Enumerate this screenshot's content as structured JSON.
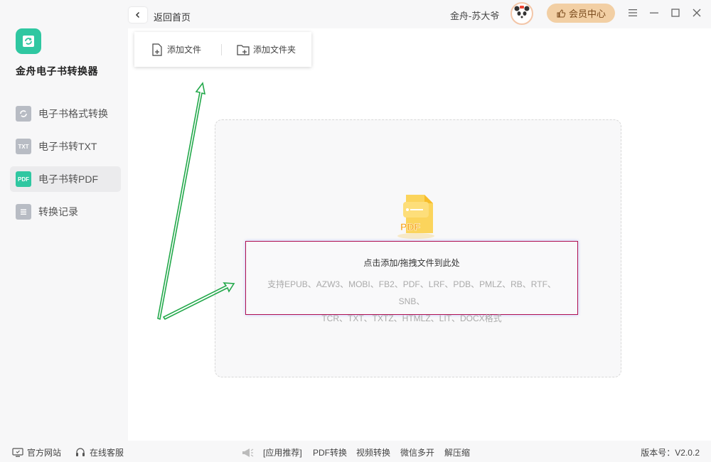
{
  "app": {
    "name": "金舟电子书转换器",
    "accent_color": "#2fc7a1",
    "logo_icon": "book-refresh-icon"
  },
  "sidebar": {
    "items": [
      {
        "label": "电子书格式转换",
        "icon": "convert-icon",
        "active": false
      },
      {
        "label": "电子书转TXT",
        "icon": "txt-icon",
        "icon_text": "TXT",
        "active": false
      },
      {
        "label": "电子书转PDF",
        "icon": "pdf-icon",
        "icon_text": "PDF",
        "active": true
      },
      {
        "label": "转换记录",
        "icon": "history-icon",
        "active": false
      }
    ]
  },
  "header": {
    "back_label": "返回首页",
    "username": "金舟-苏大爷",
    "vip_label": "会员中心",
    "vip_color": "#f2cfa4"
  },
  "add_menu": {
    "add_file": "添加文件",
    "add_folder": "添加文件夹"
  },
  "dropzone": {
    "title": "点击添加/拖拽文件到此处",
    "formats_line1": "支持EPUB、AZW3、MOBI、FB2、PDF、LRF、PDB、PMLZ、RB、RTF、SNB、",
    "formats_line2": "TCR、TXT、TXTZ、HTMLZ、LIT、DOCX格式",
    "graphic_text": "PDF",
    "highlight_color": "#b01050",
    "arrow_color": "#22a84a"
  },
  "footer": {
    "website": "官方网站",
    "support": "在线客服",
    "recommend": "[应用推荐]",
    "links": [
      "PDF转换",
      "视频转换",
      "微信多开",
      "解压缩"
    ],
    "version": "版本号：V2.0.2"
  }
}
